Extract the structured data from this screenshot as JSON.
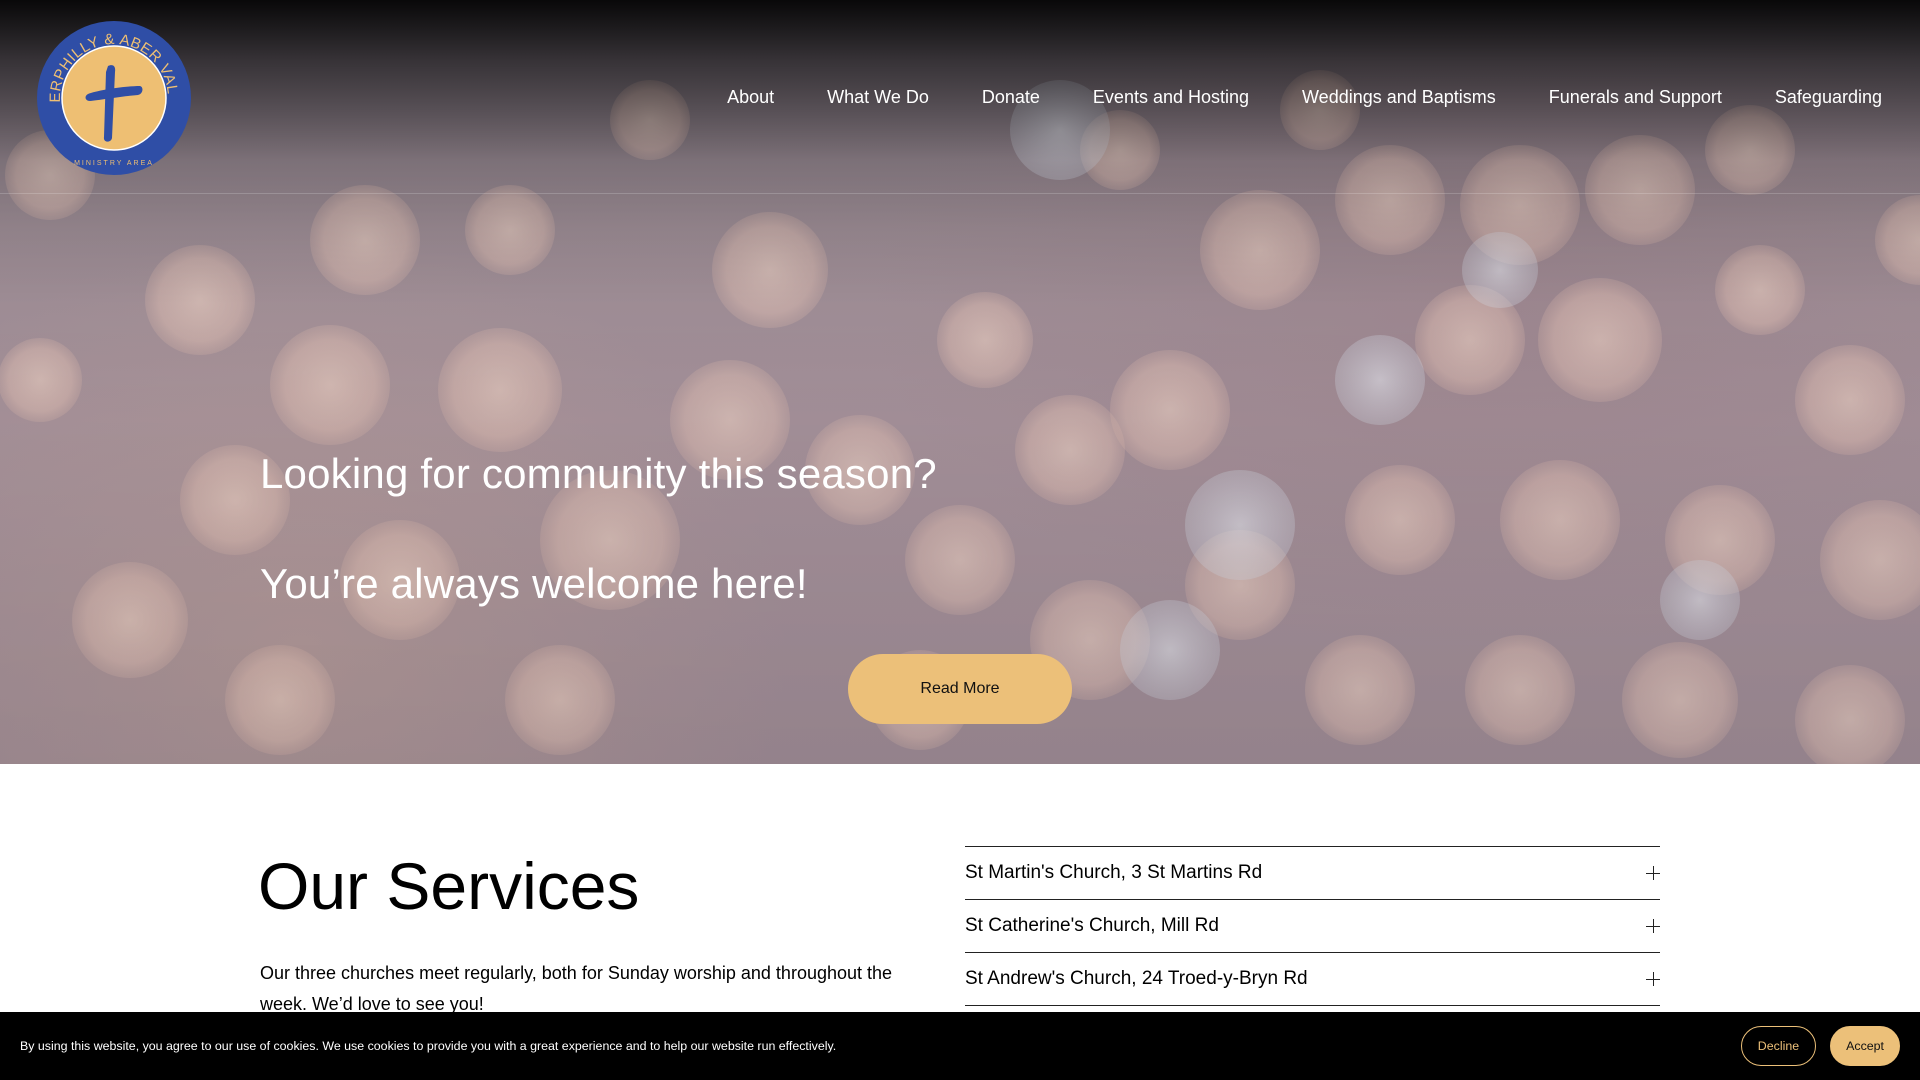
{
  "colors": {
    "accent": "#ecc079",
    "logo_blue": "#2f4ea6",
    "logo_gold": "#eebf73",
    "cookie_bg": "#000000"
  },
  "logo": {
    "icon": "cross-icon",
    "ring_text": "CAERPHILLY & ABER VALLEY",
    "sub_text": "MINISTRY AREA"
  },
  "nav": {
    "items": [
      {
        "label": "About"
      },
      {
        "label": "What We Do"
      },
      {
        "label": "Donate"
      },
      {
        "label": "Events and Hosting"
      },
      {
        "label": "Weddings and Baptisms"
      },
      {
        "label": "Funerals and Support"
      },
      {
        "label": "Safeguarding"
      }
    ]
  },
  "hero": {
    "line1": "Looking for community this season?",
    "line2": "You’re always welcome here!",
    "button_label": "Read More"
  },
  "services": {
    "title": "Our Services",
    "description": "Our three churches meet regularly, both for Sunday worship and throughout the week. We’d love to see you!",
    "churches": [
      {
        "label": "St Martin's Church, 3 St Martins Rd",
        "icon": "plus-icon"
      },
      {
        "label": "St Catherine's Church, Mill Rd",
        "icon": "plus-icon"
      },
      {
        "label": "St Andrew's Church, 24 Troed-y-Bryn Rd",
        "icon": "plus-icon"
      }
    ]
  },
  "cookie": {
    "text": "By using this website, you agree to our use of cookies. We use cookies to provide you with a great experience and to help our website run effectively.",
    "decline_label": "Decline",
    "accept_label": "Accept"
  }
}
